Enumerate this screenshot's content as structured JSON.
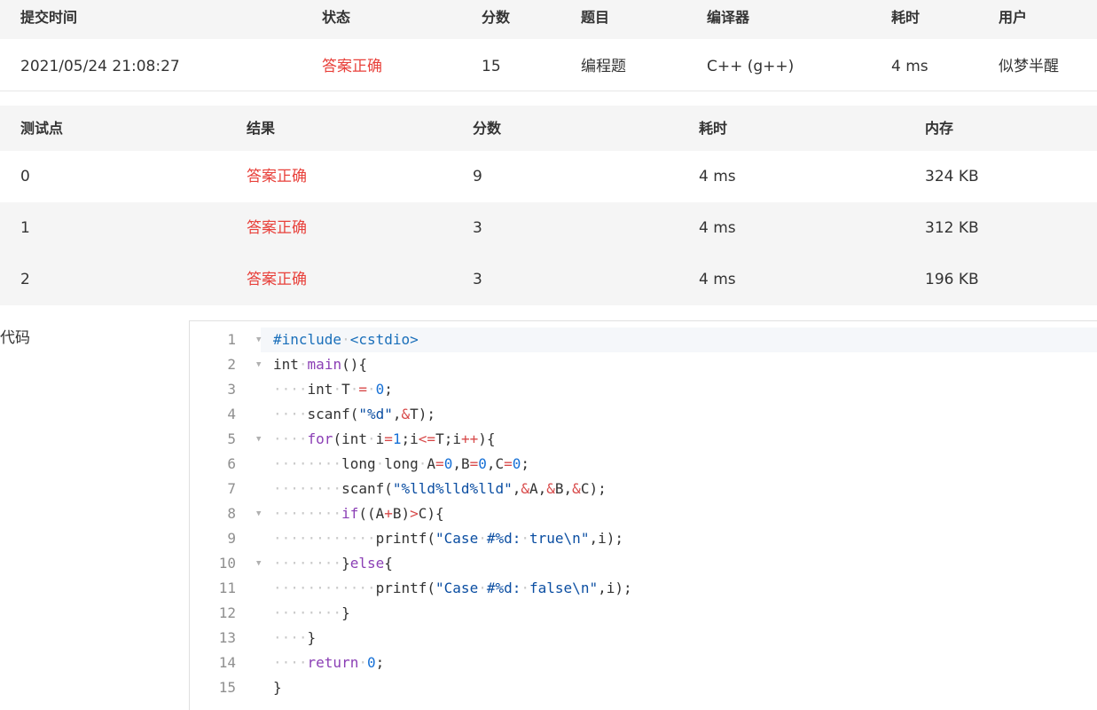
{
  "summary": {
    "headers": [
      "提交时间",
      "状态",
      "分数",
      "题目",
      "编译器",
      "耗时",
      "用户"
    ],
    "row": [
      "2021/05/24 21:08:27",
      "答案正确",
      "15",
      "编程题",
      "C++ (g++)",
      "4 ms",
      "似梦半醒"
    ]
  },
  "cases": {
    "headers": [
      "测试点",
      "结果",
      "分数",
      "耗时",
      "内存"
    ],
    "rows": [
      [
        "0",
        "答案正确",
        "9",
        "4 ms",
        "324 KB"
      ],
      [
        "1",
        "答案正确",
        "3",
        "4 ms",
        "312 KB"
      ],
      [
        "2",
        "答案正确",
        "3",
        "4 ms",
        "196 KB"
      ]
    ]
  },
  "code_label": "代码",
  "code": {
    "lines": [
      "#include <cstdio>",
      "int main(){",
      "    int T = 0;",
      "    scanf(\"%d\",&T);",
      "    for(int i=1;i<=T;i++){",
      "        long long A=0,B=0,C=0;",
      "        scanf(\"%lld%lld%lld\",&A,&B,&C);",
      "        if((A+B)>C){",
      "            printf(\"Case #%d: true\\n\",i);",
      "        }else{",
      "            printf(\"Case #%d: false\\n\",i);",
      "        }",
      "    }",
      "    return 0;",
      "}"
    ],
    "fold_lines": [
      1,
      2,
      5,
      8,
      10
    ]
  },
  "colors": {
    "accepted": "#e8413b",
    "header_bg": "#f5f5f5"
  }
}
